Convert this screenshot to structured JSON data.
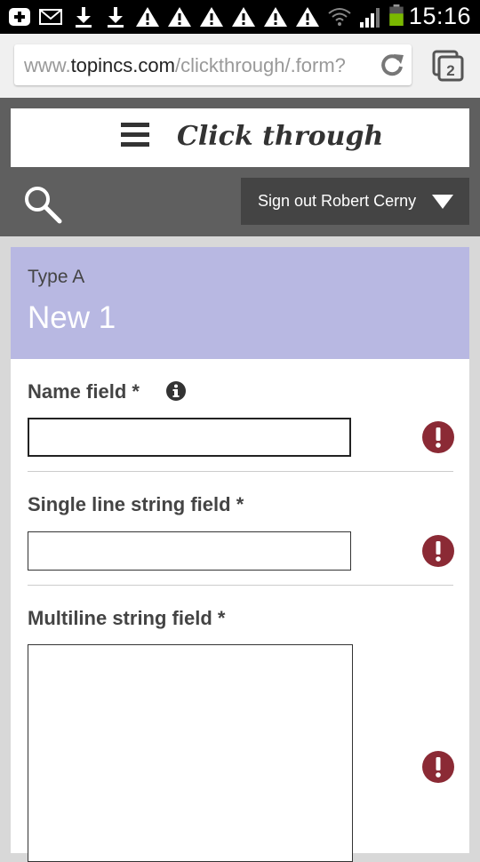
{
  "status_bar": {
    "time": "15:16",
    "icons": [
      "add-box-icon",
      "mail-icon",
      "download-icon",
      "download-icon",
      "warning-icon",
      "warning-icon",
      "warning-icon",
      "warning-icon",
      "warning-icon",
      "wifi-icon",
      "signal-icon",
      "battery-icon"
    ]
  },
  "browser": {
    "url_prefix": "www.",
    "url_domain": "topincs.com",
    "url_path": "/clickthrough/.form?",
    "tab_count": "2"
  },
  "site": {
    "title": "Click through",
    "signout_label": "Sign out Robert Cerny"
  },
  "record": {
    "type_label": "Type A",
    "title": "New 1"
  },
  "form": {
    "fields": [
      {
        "label": "Name field *",
        "value": ""
      },
      {
        "label": "Single line string field *",
        "value": ""
      },
      {
        "label": "Multiline string field *",
        "value": ""
      }
    ]
  },
  "colors": {
    "header_bg": "#5f5f5f",
    "signout_bg": "#444444",
    "type_panel_bg": "#b8b8e2",
    "error": "#8b2a35"
  }
}
